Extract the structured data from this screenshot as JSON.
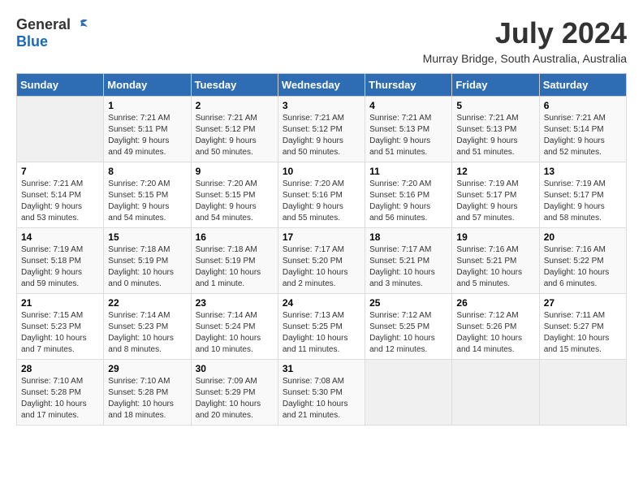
{
  "header": {
    "logo_general": "General",
    "logo_blue": "Blue",
    "month_year": "July 2024",
    "location": "Murray Bridge, South Australia, Australia"
  },
  "weekdays": [
    "Sunday",
    "Monday",
    "Tuesday",
    "Wednesday",
    "Thursday",
    "Friday",
    "Saturday"
  ],
  "weeks": [
    [
      {
        "day": "",
        "info": ""
      },
      {
        "day": "1",
        "info": "Sunrise: 7:21 AM\nSunset: 5:11 PM\nDaylight: 9 hours\nand 49 minutes."
      },
      {
        "day": "2",
        "info": "Sunrise: 7:21 AM\nSunset: 5:12 PM\nDaylight: 9 hours\nand 50 minutes."
      },
      {
        "day": "3",
        "info": "Sunrise: 7:21 AM\nSunset: 5:12 PM\nDaylight: 9 hours\nand 50 minutes."
      },
      {
        "day": "4",
        "info": "Sunrise: 7:21 AM\nSunset: 5:13 PM\nDaylight: 9 hours\nand 51 minutes."
      },
      {
        "day": "5",
        "info": "Sunrise: 7:21 AM\nSunset: 5:13 PM\nDaylight: 9 hours\nand 51 minutes."
      },
      {
        "day": "6",
        "info": "Sunrise: 7:21 AM\nSunset: 5:14 PM\nDaylight: 9 hours\nand 52 minutes."
      }
    ],
    [
      {
        "day": "7",
        "info": "Sunrise: 7:21 AM\nSunset: 5:14 PM\nDaylight: 9 hours\nand 53 minutes."
      },
      {
        "day": "8",
        "info": "Sunrise: 7:20 AM\nSunset: 5:15 PM\nDaylight: 9 hours\nand 54 minutes."
      },
      {
        "day": "9",
        "info": "Sunrise: 7:20 AM\nSunset: 5:15 PM\nDaylight: 9 hours\nand 54 minutes."
      },
      {
        "day": "10",
        "info": "Sunrise: 7:20 AM\nSunset: 5:16 PM\nDaylight: 9 hours\nand 55 minutes."
      },
      {
        "day": "11",
        "info": "Sunrise: 7:20 AM\nSunset: 5:16 PM\nDaylight: 9 hours\nand 56 minutes."
      },
      {
        "day": "12",
        "info": "Sunrise: 7:19 AM\nSunset: 5:17 PM\nDaylight: 9 hours\nand 57 minutes."
      },
      {
        "day": "13",
        "info": "Sunrise: 7:19 AM\nSunset: 5:17 PM\nDaylight: 9 hours\nand 58 minutes."
      }
    ],
    [
      {
        "day": "14",
        "info": "Sunrise: 7:19 AM\nSunset: 5:18 PM\nDaylight: 9 hours\nand 59 minutes."
      },
      {
        "day": "15",
        "info": "Sunrise: 7:18 AM\nSunset: 5:19 PM\nDaylight: 10 hours\nand 0 minutes."
      },
      {
        "day": "16",
        "info": "Sunrise: 7:18 AM\nSunset: 5:19 PM\nDaylight: 10 hours\nand 1 minute."
      },
      {
        "day": "17",
        "info": "Sunrise: 7:17 AM\nSunset: 5:20 PM\nDaylight: 10 hours\nand 2 minutes."
      },
      {
        "day": "18",
        "info": "Sunrise: 7:17 AM\nSunset: 5:21 PM\nDaylight: 10 hours\nand 3 minutes."
      },
      {
        "day": "19",
        "info": "Sunrise: 7:16 AM\nSunset: 5:21 PM\nDaylight: 10 hours\nand 5 minutes."
      },
      {
        "day": "20",
        "info": "Sunrise: 7:16 AM\nSunset: 5:22 PM\nDaylight: 10 hours\nand 6 minutes."
      }
    ],
    [
      {
        "day": "21",
        "info": "Sunrise: 7:15 AM\nSunset: 5:23 PM\nDaylight: 10 hours\nand 7 minutes."
      },
      {
        "day": "22",
        "info": "Sunrise: 7:14 AM\nSunset: 5:23 PM\nDaylight: 10 hours\nand 8 minutes."
      },
      {
        "day": "23",
        "info": "Sunrise: 7:14 AM\nSunset: 5:24 PM\nDaylight: 10 hours\nand 10 minutes."
      },
      {
        "day": "24",
        "info": "Sunrise: 7:13 AM\nSunset: 5:25 PM\nDaylight: 10 hours\nand 11 minutes."
      },
      {
        "day": "25",
        "info": "Sunrise: 7:12 AM\nSunset: 5:25 PM\nDaylight: 10 hours\nand 12 minutes."
      },
      {
        "day": "26",
        "info": "Sunrise: 7:12 AM\nSunset: 5:26 PM\nDaylight: 10 hours\nand 14 minutes."
      },
      {
        "day": "27",
        "info": "Sunrise: 7:11 AM\nSunset: 5:27 PM\nDaylight: 10 hours\nand 15 minutes."
      }
    ],
    [
      {
        "day": "28",
        "info": "Sunrise: 7:10 AM\nSunset: 5:28 PM\nDaylight: 10 hours\nand 17 minutes."
      },
      {
        "day": "29",
        "info": "Sunrise: 7:10 AM\nSunset: 5:28 PM\nDaylight: 10 hours\nand 18 minutes."
      },
      {
        "day": "30",
        "info": "Sunrise: 7:09 AM\nSunset: 5:29 PM\nDaylight: 10 hours\nand 20 minutes."
      },
      {
        "day": "31",
        "info": "Sunrise: 7:08 AM\nSunset: 5:30 PM\nDaylight: 10 hours\nand 21 minutes."
      },
      {
        "day": "",
        "info": ""
      },
      {
        "day": "",
        "info": ""
      },
      {
        "day": "",
        "info": ""
      }
    ]
  ]
}
